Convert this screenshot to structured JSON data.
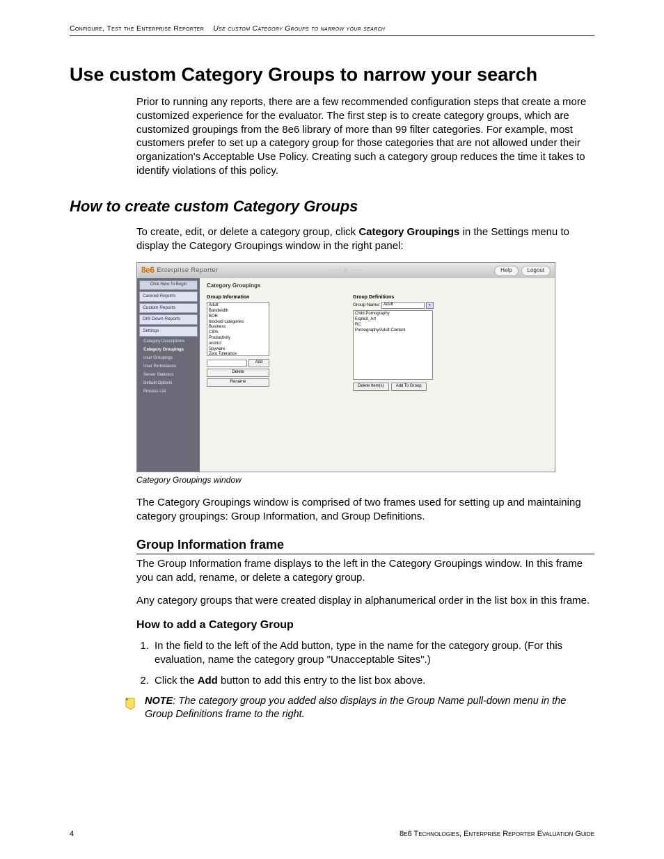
{
  "running_header": {
    "left": "Configure, Test the Enterprise Reporter",
    "right": "Use custom Category Groups to narrow your search"
  },
  "h1": "Use custom Category Groups to narrow your search",
  "intro": "Prior to running any reports, there are a few recommended configuration steps that create a more customized experience for the evaluator. The first step is to create category groups, which are customized groupings from the 8e6 library of more than 99 filter categories. For example, most customers prefer to set up a category group for those categories that are not allowed under their organization's Acceptable Use Policy. Creating such a category group reduces the time it takes to identify violations of this policy.",
  "h2": "How to create custom Category Groups",
  "p2a": "To create, edit, or delete a category group, click ",
  "p2b": "Category Groupings",
  "p2c": " in the Settings menu to display the Category Groupings window in the right panel:",
  "caption": "Category Groupings window",
  "p3": "The Category Groupings window is comprised of two frames used for setting up and maintaining category groupings: Group Information, and Group Definitions.",
  "h3": "Group Information frame",
  "p4": "The Group Information frame displays to the left in the Category Groupings window. In this frame you can add, rename, or delete a category group.",
  "p5": "Any category groups that were created display in alphanumerical order in the list box in this frame.",
  "h4": "How to add a Category Group",
  "step1": "In the field to the left of the Add button, type in the name for the category group. (For this evaluation, name the category group \"Unacceptable Sites\".)",
  "step2a": "Click the ",
  "step2b": "Add",
  "step2c": " button to add this entry to the list box above.",
  "note_label": "NOTE",
  "note_text": ": The category group you added also displays in the Group Name pull-down menu in the Group Definitions frame to the right.",
  "footer": {
    "page": "4",
    "right": "8e6 Technologies, Enterprise Reporter Evaluation Guide"
  },
  "screenshot": {
    "logo": "8e6",
    "app_title": "Enterprise Reporter",
    "help_btn": "Help",
    "logout_btn": "Logout",
    "nav_header": "Click Here To Begin",
    "nav": [
      "Canned Reports",
      "Custom Reports",
      "Drill Down Reports",
      "Settings"
    ],
    "settings_children": [
      "Category Descriptions",
      "Category Groupings",
      "User Groupings",
      "User Permissions",
      "Server Statistics",
      "Default Options",
      "Process List"
    ],
    "panel_title": "Category Groupings",
    "group_info_label": "Group Information",
    "group_info_items": [
      "Adult",
      "Bandwidth",
      "BOR",
      "blocked categories",
      "Business",
      "CIPA",
      "Productivity",
      "restrict",
      "Spyware",
      "Zero Tolerance"
    ],
    "add_btn": "Add",
    "delete_btn": "Delete",
    "rename_btn": "Rename",
    "group_def_label": "Group Definitions",
    "group_name_label": "Group Name:",
    "group_name_value": "Adult",
    "group_def_items": [
      "Child Pornography",
      "Explicit_Art",
      "RC",
      "Pornography/Adult Content"
    ],
    "delete_items_btn": "Delete Item(s)",
    "add_to_group_btn": "Add To Group"
  }
}
